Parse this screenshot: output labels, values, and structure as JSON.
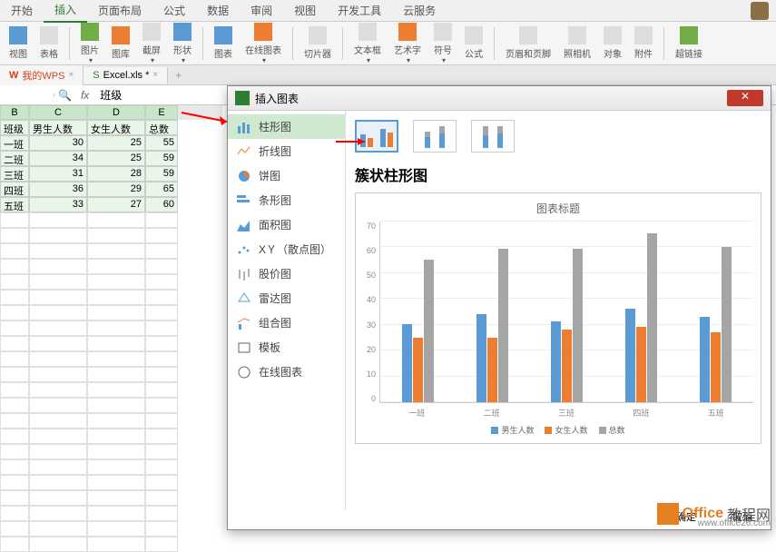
{
  "ribbon": {
    "tabs": [
      "开始",
      "插入",
      "页面布局",
      "公式",
      "数据",
      "审阅",
      "视图",
      "开发工具",
      "云服务"
    ],
    "active": "插入"
  },
  "toolbar": {
    "items": [
      "视图",
      "表格",
      "图片",
      "图库",
      "截屏",
      "形状",
      "图表",
      "在线图表",
      "切片器",
      "文本框",
      "艺术字",
      "符号",
      "公式",
      "页眉和页脚",
      "对象",
      "照相机",
      "附件",
      "超链接"
    ]
  },
  "docs": {
    "tab1": "我的WPS",
    "tab2": "Excel.xls *"
  },
  "formula": {
    "fx": "fx",
    "value": "班级"
  },
  "sheet": {
    "cols": [
      "B",
      "C",
      "D",
      "E"
    ],
    "headers": [
      "班级",
      "男生人数",
      "女生人数",
      "总数"
    ],
    "rows": [
      {
        "class": "一班",
        "male": "30",
        "female": "25",
        "total": "55"
      },
      {
        "class": "二班",
        "male": "34",
        "female": "25",
        "total": "59"
      },
      {
        "class": "三班",
        "male": "31",
        "female": "28",
        "total": "59"
      },
      {
        "class": "四班",
        "male": "36",
        "female": "29",
        "total": "65"
      },
      {
        "class": "五班",
        "male": "33",
        "female": "27",
        "total": "60"
      }
    ]
  },
  "dialog": {
    "title": "插入图表",
    "types": [
      "柱形图",
      "折线图",
      "饼图",
      "条形图",
      "面积图",
      "XＹ（散点图）",
      "股价图",
      "雷达图",
      "组合图",
      "模板",
      "在线图表"
    ],
    "subtitle": "簇状柱形图",
    "chart_title": "图表标题",
    "ok": "确定",
    "cancel": "取消"
  },
  "chart_data": {
    "type": "bar",
    "categories": [
      "一班",
      "二班",
      "三班",
      "四班",
      "五班"
    ],
    "series": [
      {
        "name": "男生人数",
        "values": [
          30,
          34,
          31,
          36,
          33
        ],
        "color": "#5b9bd5"
      },
      {
        "name": "女生人数",
        "values": [
          25,
          25,
          28,
          29,
          27
        ],
        "color": "#ed7d31"
      },
      {
        "name": "总数",
        "values": [
          55,
          59,
          59,
          65,
          60
        ],
        "color": "#a5a5a5"
      }
    ],
    "ylim": [
      0,
      70
    ],
    "yticks": [
      0,
      10,
      20,
      30,
      40,
      50,
      60,
      70
    ],
    "title": "图表标题"
  },
  "watermark": {
    "text1": "Office",
    "text2": "教程网",
    "url": "www.office26.com"
  }
}
